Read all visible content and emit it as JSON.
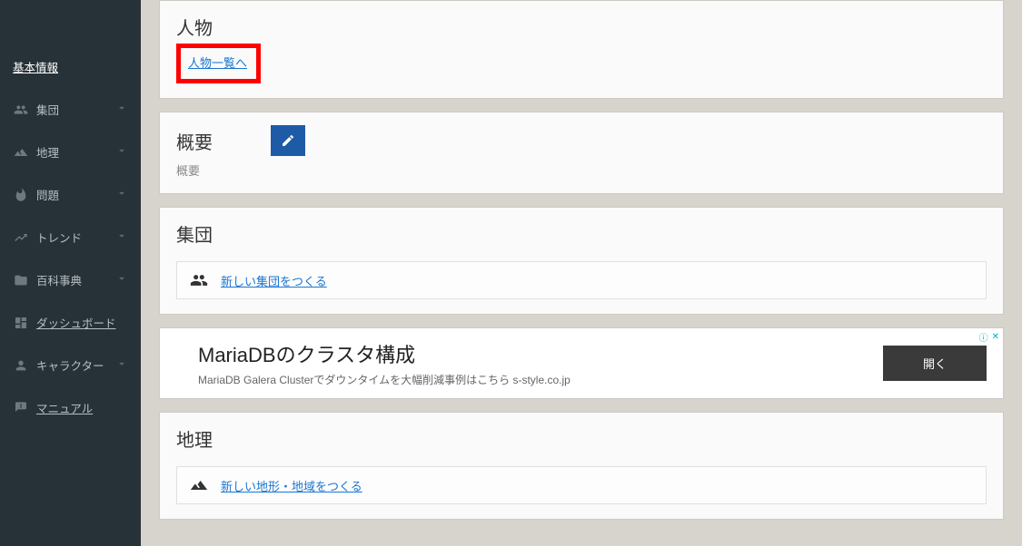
{
  "sidebar": {
    "items": [
      {
        "label": "基本情報"
      },
      {
        "label": "集団"
      },
      {
        "label": "地理"
      },
      {
        "label": "問題"
      },
      {
        "label": "トレンド"
      },
      {
        "label": "百科事典"
      },
      {
        "label": "ダッシュボード"
      },
      {
        "label": "キャラクター"
      },
      {
        "label": "マニュアル"
      }
    ]
  },
  "section_person": {
    "title": "人物",
    "link": "人物一覧へ"
  },
  "section_overview": {
    "title": "概要",
    "sub": "概要"
  },
  "section_group": {
    "title": "集団",
    "action": "新しい集団をつくる"
  },
  "ad": {
    "title": "MariaDBのクラスタ構成",
    "sub": "MariaDB Galera Clusterでダウンタイムを大幅削減事例はこちら s-style.co.jp",
    "button": "開く"
  },
  "section_geo": {
    "title": "地理",
    "action": "新しい地形・地域をつくる"
  }
}
